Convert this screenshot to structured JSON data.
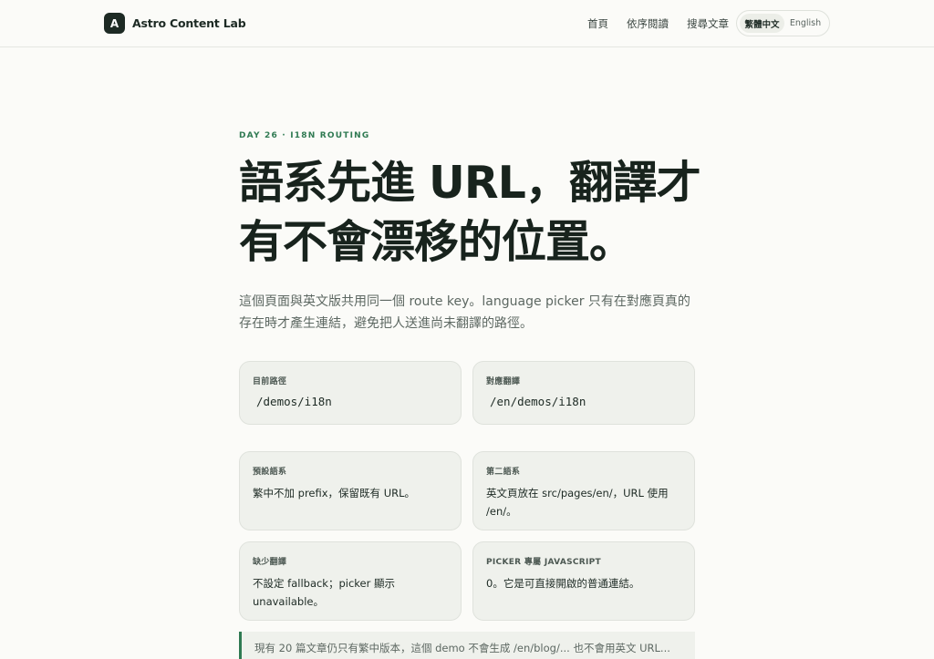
{
  "brand": {
    "mark": "A",
    "name": "Astro Content Lab"
  },
  "nav": {
    "items": [
      "首頁",
      "依序閱讀",
      "搜尋文章"
    ]
  },
  "lang_picker": {
    "active": "繁體中文",
    "other": "English"
  },
  "hero": {
    "eyebrow": "DAY 26 · I18N ROUTING",
    "title_line1": "語系先進 URL，翻譯才",
    "title_line2": "有不會漂移的位置。",
    "lede": "這個頁面與英文版共用同一個 route key。language picker 只有在對應頁真的存在時才產生連結，避免把人送進尚未翻譯的路徑。"
  },
  "cards": {
    "current_path": {
      "label": "目前路徑",
      "value": "/demos/i18n"
    },
    "translation": {
      "label": "對應翻譯",
      "value": "/en/demos/i18n"
    },
    "default_lang": {
      "label": "預設語系",
      "text": "繁中不加 prefix，保留既有 URL。"
    },
    "second_lang": {
      "label": "第二語系",
      "text": "英文頁放在 src/pages/en/，URL 使用 /en/。"
    },
    "missing": {
      "label": "缺少翻譯",
      "text": "不設定 fallback；picker 顯示 unavailable。"
    },
    "picker_js": {
      "label": "PICKER 專屬 JAVASCRIPT",
      "text": "0。它是可直接開啟的普通連結。"
    }
  },
  "note": {
    "text": "現有 20 篇文章仍只有繁中版本，這個 demo 不會生成 /en/blog/... 也不會用英文 URL..."
  },
  "colors": {
    "accent": "#2f7a52",
    "ink": "#18231d",
    "card_bg": "#eff1ec"
  }
}
